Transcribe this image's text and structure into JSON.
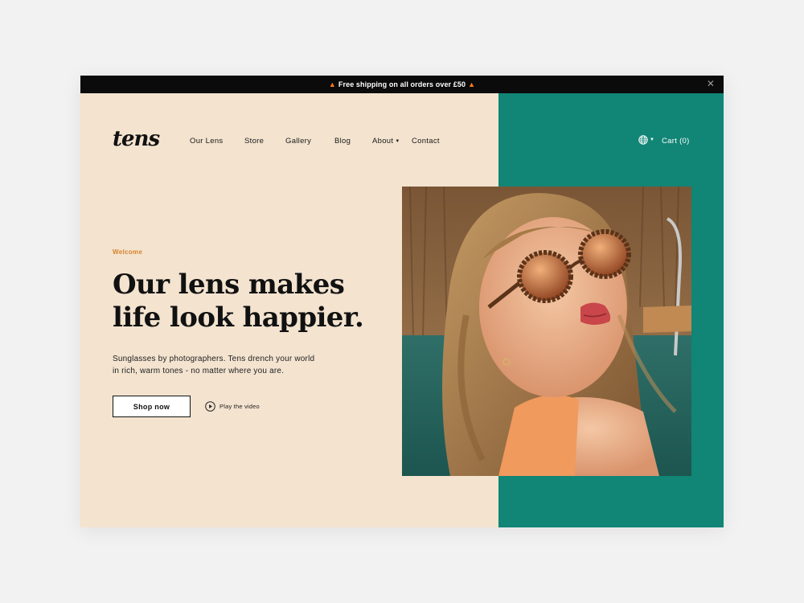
{
  "announcement": {
    "icon": "fire-icon",
    "text": "Free shipping on all orders over £50"
  },
  "brand": {
    "logo_text": "tens"
  },
  "nav": {
    "items": [
      {
        "label": "Our Lens"
      },
      {
        "label": "Store"
      },
      {
        "label": "Gallery"
      },
      {
        "label": "Blog"
      },
      {
        "label": "About",
        "has_dropdown": true
      },
      {
        "label": "Contact"
      }
    ]
  },
  "header": {
    "language_icon": "globe-icon",
    "cart_label": "Cart (0)"
  },
  "hero": {
    "eyebrow": "Welcome",
    "headline_line1": "Our lens makes",
    "headline_line2": "life look happier.",
    "subtext_line1": "Sunglasses by photographers. Tens drench your world",
    "subtext_line2": "in rich, warm tones - no matter where you are.",
    "cta_label": "Shop now",
    "video_label": "Play the video",
    "video_icon": "play-icon"
  },
  "colors": {
    "cream": "#f3e3cf",
    "teal": "#118576",
    "accent": "#d9822b",
    "bar": "#0b0b0b"
  }
}
